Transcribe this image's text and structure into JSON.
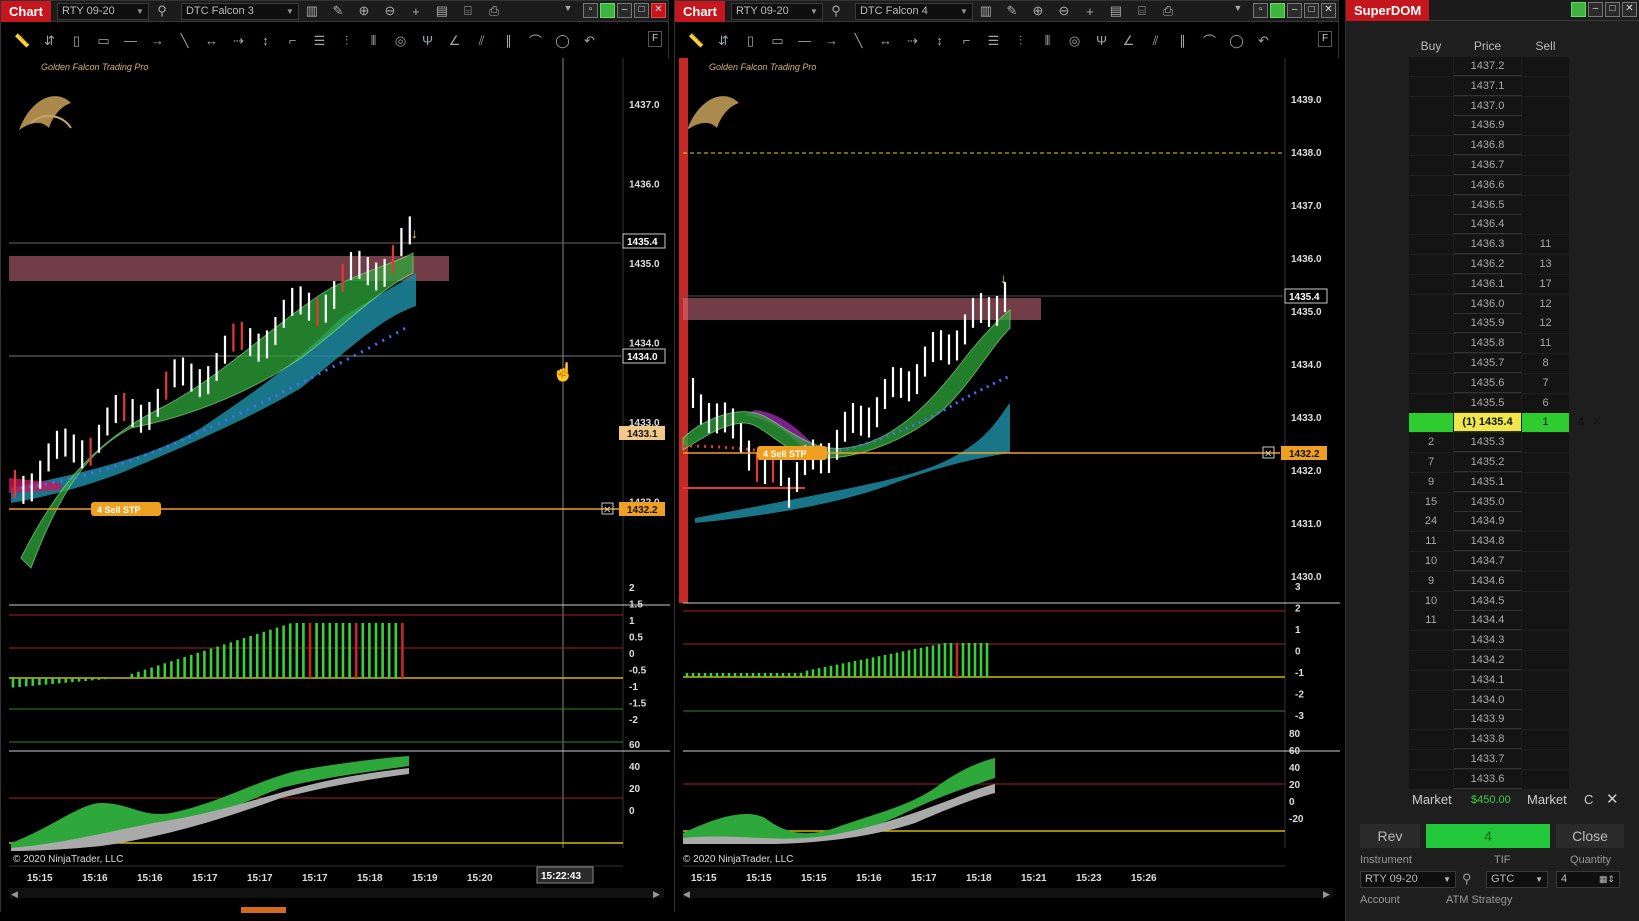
{
  "left_chart": {
    "title": "Chart",
    "instrument": "RTY 09-20",
    "template": "DTC Falcon 3",
    "watermark": "Golden Falcon Trading Pro",
    "copyright": "© 2020 NinjaTrader, LLC",
    "f_button": "F",
    "price_axis": [
      "1437.0",
      "1436.0",
      "1435.0",
      "1434.0",
      "1433.0",
      "1432.0"
    ],
    "price_markers": {
      "last": "1435.4",
      "line": "1434.0",
      "pending": "1433.1",
      "order": "1432.2"
    },
    "order_tag": "4  Sell  STP",
    "osc_axis": [
      "2",
      "1.5",
      "1",
      "0.5",
      "0",
      "-0.5",
      "-1",
      "-1.5",
      "-2"
    ],
    "bottom_axis": [
      "60",
      "40",
      "20",
      "0"
    ],
    "time_axis": [
      "15:15",
      "15:16",
      "15:16",
      "15:17",
      "15:17",
      "15:17",
      "15:18",
      "15:19",
      "15:20"
    ],
    "cursor_time": "15:22:43"
  },
  "right_chart": {
    "title": "Chart",
    "instrument": "RTY 09-20",
    "template": "DTC Falcon 4",
    "watermark": "Golden Falcon Trading Pro",
    "copyright": "© 2020 NinjaTrader, LLC",
    "f_button": "F",
    "price_axis": [
      "1439.0",
      "1438.0",
      "1437.0",
      "1436.0",
      "1435.0",
      "1434.0",
      "1433.0",
      "1432.0",
      "1431.0",
      "1430.0"
    ],
    "price_markers": {
      "last": "1435.4",
      "order": "1432.2"
    },
    "order_tag": "4  Sell  STP",
    "osc_axis": [
      "3",
      "2",
      "1",
      "0",
      "-1",
      "-2",
      "-3"
    ],
    "bottom_axis": [
      "80",
      "60",
      "40",
      "20",
      "0",
      "-20"
    ],
    "time_axis": [
      "15:15",
      "15:15",
      "15:15",
      "15:16",
      "15:17",
      "15:18",
      "15:21",
      "15:23",
      "15:26"
    ]
  },
  "superdom": {
    "title": "SuperDOM",
    "headers": {
      "buy": "Buy",
      "price": "Price",
      "sell": "Sell"
    },
    "ladder": [
      {
        "buy": "",
        "price": "1437.2",
        "sell": ""
      },
      {
        "buy": "",
        "price": "1437.1",
        "sell": ""
      },
      {
        "buy": "",
        "price": "1437.0",
        "sell": ""
      },
      {
        "buy": "",
        "price": "1436.9",
        "sell": ""
      },
      {
        "buy": "",
        "price": "1436.8",
        "sell": ""
      },
      {
        "buy": "",
        "price": "1436.7",
        "sell": ""
      },
      {
        "buy": "",
        "price": "1436.6",
        "sell": ""
      },
      {
        "buy": "",
        "price": "1436.5",
        "sell": ""
      },
      {
        "buy": "",
        "price": "1436.4",
        "sell": ""
      },
      {
        "buy": "",
        "price": "1436.3",
        "sell": "11"
      },
      {
        "buy": "",
        "price": "1436.2",
        "sell": "13"
      },
      {
        "buy": "",
        "price": "1436.1",
        "sell": "17"
      },
      {
        "buy": "",
        "price": "1436.0",
        "sell": "12"
      },
      {
        "buy": "",
        "price": "1435.9",
        "sell": "12"
      },
      {
        "buy": "",
        "price": "1435.8",
        "sell": "11"
      },
      {
        "buy": "",
        "price": "1435.7",
        "sell": "8"
      },
      {
        "buy": "",
        "price": "1435.6",
        "sell": "7"
      },
      {
        "buy": "",
        "price": "1435.5",
        "sell": "6"
      },
      {
        "buy": "",
        "price": "(1) 1435.4",
        "sell": "1",
        "current": true,
        "last_size": "4"
      },
      {
        "buy": "2",
        "price": "1435.3",
        "sell": ""
      },
      {
        "buy": "7",
        "price": "1435.2",
        "sell": ""
      },
      {
        "buy": "9",
        "price": "1435.1",
        "sell": ""
      },
      {
        "buy": "15",
        "price": "1435.0",
        "sell": ""
      },
      {
        "buy": "24",
        "price": "1434.9",
        "sell": ""
      },
      {
        "buy": "11",
        "price": "1434.8",
        "sell": ""
      },
      {
        "buy": "10",
        "price": "1434.7",
        "sell": ""
      },
      {
        "buy": "9",
        "price": "1434.6",
        "sell": ""
      },
      {
        "buy": "10",
        "price": "1434.5",
        "sell": ""
      },
      {
        "buy": "11",
        "price": "1434.4",
        "sell": ""
      },
      {
        "buy": "",
        "price": "1434.3",
        "sell": ""
      },
      {
        "buy": "",
        "price": "1434.2",
        "sell": ""
      },
      {
        "buy": "",
        "price": "1434.1",
        "sell": ""
      },
      {
        "buy": "",
        "price": "1434.0",
        "sell": ""
      },
      {
        "buy": "",
        "price": "1433.9",
        "sell": ""
      },
      {
        "buy": "",
        "price": "1433.8",
        "sell": ""
      },
      {
        "buy": "",
        "price": "1433.7",
        "sell": ""
      },
      {
        "buy": "",
        "price": "1433.6",
        "sell": ""
      }
    ],
    "market_buy": "Market",
    "pnl": "$450.00",
    "market_sell": "Market",
    "c_btn": "C",
    "rev": "Rev",
    "position": "4",
    "close": "Close",
    "instrument_label": "Instrument",
    "instrument": "RTY 09-20",
    "tif_label": "TIF",
    "tif": "GTC",
    "quantity_label": "Quantity",
    "quantity": "4",
    "account_label": "Account",
    "atm_label": "ATM Strategy"
  }
}
